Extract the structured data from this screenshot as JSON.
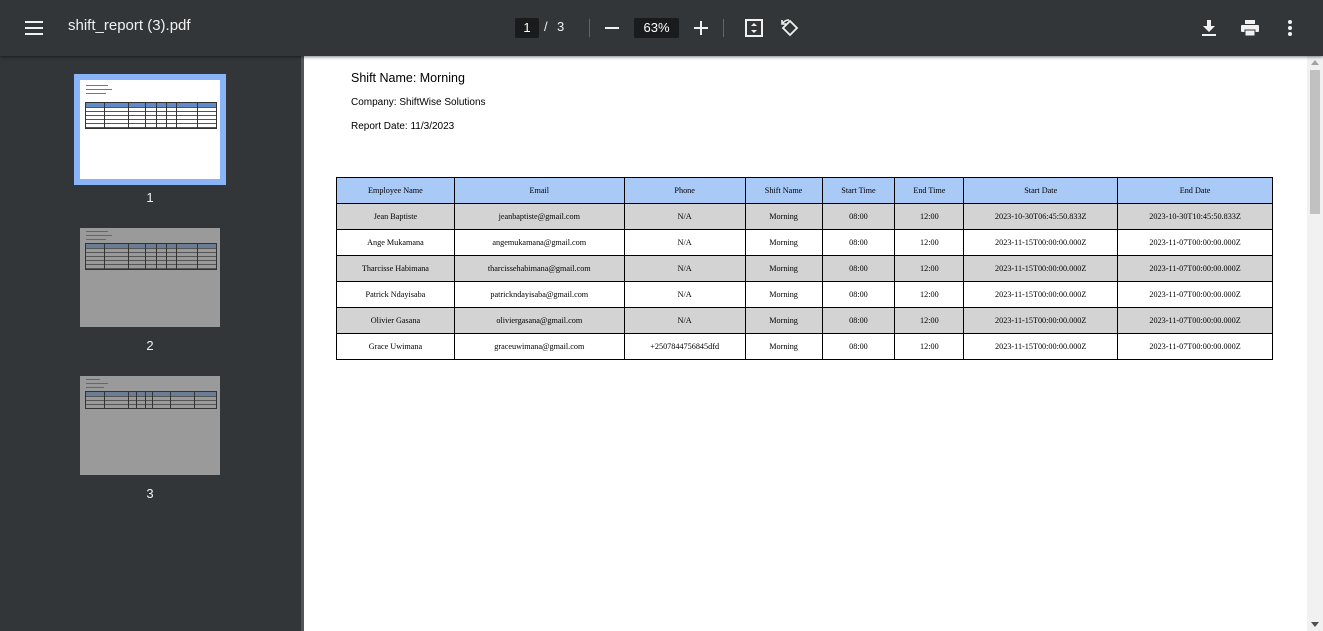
{
  "toolbar": {
    "title": "shift_report (3).pdf",
    "current_page": "1",
    "separator": "/",
    "total_pages": "3",
    "zoom": "63%"
  },
  "thumbnails": [
    {
      "label": "1"
    },
    {
      "label": "2"
    },
    {
      "label": "3"
    }
  ],
  "document": {
    "shift_name": "Shift Name: Morning",
    "company": "Company: ShiftWise Solutions",
    "report_date": "Report Date: 11/3/2023",
    "columns": [
      "Employee Name",
      "Email",
      "Phone",
      "Shift Name",
      "Start Time",
      "End Time",
      "Start Date",
      "End Date"
    ],
    "rows": [
      [
        "Jean Baptiste",
        "jeanbaptiste@gmail.com",
        "N/A",
        "Morning",
        "08:00",
        "12:00",
        "2023-10-30T06:45:50.833Z",
        "2023-10-30T10:45:50.833Z"
      ],
      [
        "Ange Mukamana",
        "angemukamana@gmail.com",
        "N/A",
        "Morning",
        "08:00",
        "12:00",
        "2023-11-15T00:00:00.000Z",
        "2023-11-07T00:00:00.000Z"
      ],
      [
        "Tharcisse Habimana",
        "tharcissehabimana@gmail.com",
        "N/A",
        "Morning",
        "08:00",
        "12:00",
        "2023-11-15T00:00:00.000Z",
        "2023-11-07T00:00:00.000Z"
      ],
      [
        "Patrick Ndayisaba",
        "patrickndayisaba@gmail.com",
        "N/A",
        "Morning",
        "08:00",
        "12:00",
        "2023-11-15T00:00:00.000Z",
        "2023-11-07T00:00:00.000Z"
      ],
      [
        "Olivier Gasana",
        "oliviergasana@gmail.com",
        "N/A",
        "Morning",
        "08:00",
        "12:00",
        "2023-11-15T00:00:00.000Z",
        "2023-11-07T00:00:00.000Z"
      ],
      [
        "Grace Uwimana",
        "graceuwimana@gmail.com",
        "+2507844756845dfd",
        "Morning",
        "08:00",
        "12:00",
        "2023-11-15T00:00:00.000Z",
        "2023-11-07T00:00:00.000Z"
      ]
    ]
  }
}
